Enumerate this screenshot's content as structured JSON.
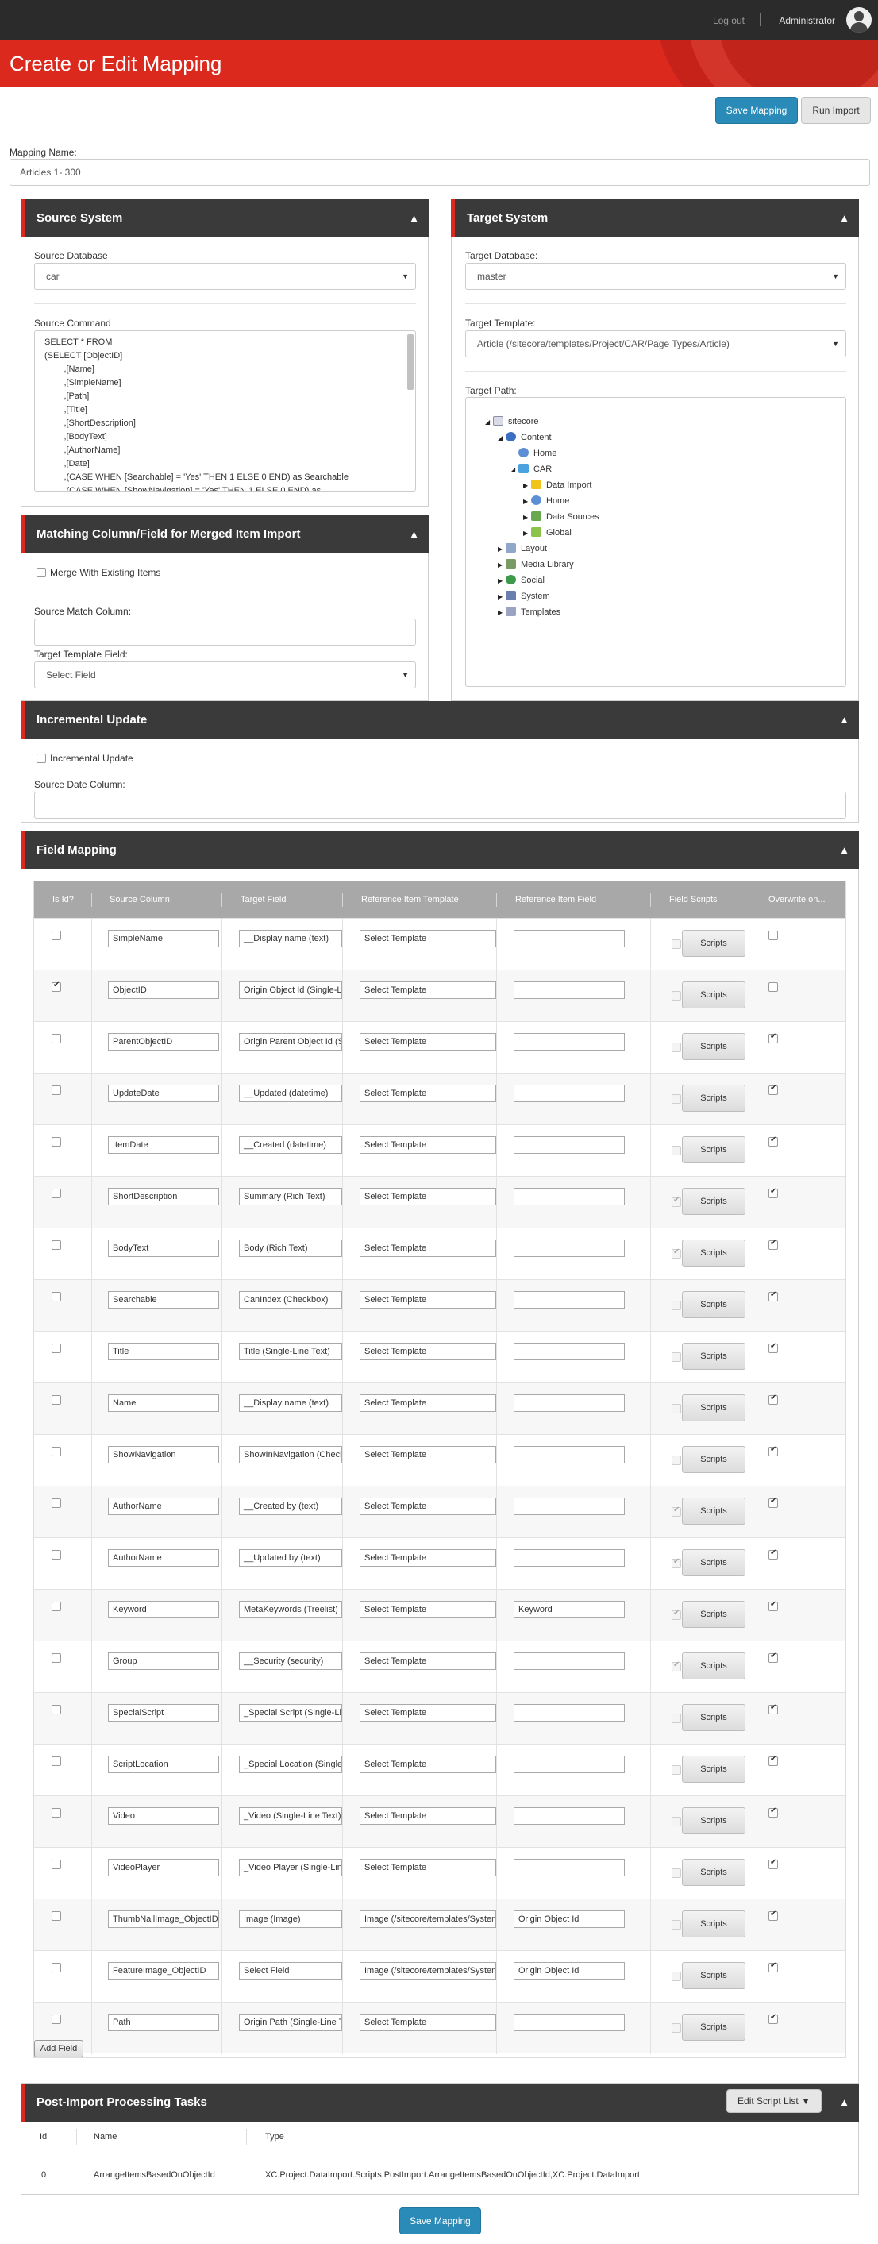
{
  "topbar": {
    "logout": "Log out",
    "user": "Administrator"
  },
  "page": {
    "title": "Create or Edit Mapping"
  },
  "actions": {
    "save": "Save Mapping",
    "run": "Run Import"
  },
  "mapping_name": {
    "label": "Mapping Name:",
    "value": "Articles 1- 300"
  },
  "source": {
    "title": "Source System",
    "db_label": "Source Database",
    "db_value": "car",
    "cmd_label": "Source Command",
    "cmd_text": "SELECT * FROM\n(SELECT [ObjectID]\n        ,[Name]\n        ,[SimpleName]\n        ,[Path]\n        ,[Title]\n        ,[ShortDescription]\n        ,[BodyText]\n        ,[AuthorName]\n        ,[Date]\n        ,(CASE WHEN [Searchable] = 'Yes' THEN 1 ELSE 0 END) as Searchable\n        ,(CASE WHEN [ShowNavigation] = 'Yes' THEN 1 ELSE 0 END) as"
  },
  "target": {
    "title": "Target System",
    "db_label": "Target Database:",
    "db_value": "master",
    "tpl_label": "Target Template:",
    "tpl_value": "Article (/sitecore/templates/Project/CAR/Page Types/Article)",
    "path_label": "Target Path:",
    "tree": [
      "sitecore",
      "Content",
      "Home",
      "CAR",
      "Data Import",
      "Home",
      "Data Sources",
      "Global",
      "Layout",
      "Media Library",
      "Social",
      "System",
      "Templates"
    ]
  },
  "merge": {
    "title": "Matching Column/Field for Merged Item Import",
    "checkbox": "Merge With Existing Items",
    "match_label": "Source Match Column:",
    "tpl_field_label": "Target Template Field:",
    "tpl_field_value": "Select Field"
  },
  "incremental": {
    "title": "Incremental Update",
    "checkbox": "Incremental Update",
    "date_label": "Source Date Column:"
  },
  "field_mapping": {
    "title": "Field Mapping",
    "columns": [
      "Is Id?",
      "Source Column",
      "Target Field",
      "Reference Item Template",
      "Reference Item Field",
      "Field Scripts",
      "Overwrite on..."
    ],
    "scripts_label": "Scripts",
    "add_field": "Add Field",
    "rows": [
      {
        "isid": false,
        "source": "SimpleName",
        "target": "__Display name (text)",
        "tpl": "Select Template",
        "ref": "",
        "script": false,
        "ow": false
      },
      {
        "isid": true,
        "source": "ObjectID",
        "target": "Origin Object Id (Single-Line Text)",
        "tpl": "Select Template",
        "ref": "",
        "script": false,
        "ow": false
      },
      {
        "isid": false,
        "source": "ParentObjectID",
        "target": "Origin Parent Object Id (Single-Line Text)",
        "tpl": "Select Template",
        "ref": "",
        "script": false,
        "ow": true
      },
      {
        "isid": false,
        "source": "UpdateDate",
        "target": "__Updated (datetime)",
        "tpl": "Select Template",
        "ref": "",
        "script": false,
        "ow": true
      },
      {
        "isid": false,
        "source": "ItemDate",
        "target": "__Created (datetime)",
        "tpl": "Select Template",
        "ref": "",
        "script": false,
        "ow": true
      },
      {
        "isid": false,
        "source": "ShortDescription",
        "target": "Summary (Rich Text)",
        "tpl": "Select Template",
        "ref": "",
        "script": true,
        "ow": true
      },
      {
        "isid": false,
        "source": "BodyText",
        "target": "Body (Rich Text)",
        "tpl": "Select Template",
        "ref": "",
        "script": true,
        "ow": true
      },
      {
        "isid": false,
        "source": "Searchable",
        "target": "CanIndex (Checkbox)",
        "tpl": "Select Template",
        "ref": "",
        "script": false,
        "ow": true
      },
      {
        "isid": false,
        "source": "Title",
        "target": "Title (Single-Line Text)",
        "tpl": "Select Template",
        "ref": "",
        "script": false,
        "ow": true
      },
      {
        "isid": false,
        "source": "Name",
        "target": "__Display name (text)",
        "tpl": "Select Template",
        "ref": "",
        "script": false,
        "ow": true
      },
      {
        "isid": false,
        "source": "ShowNavigation",
        "target": "ShowInNavigation (Checkbox)",
        "tpl": "Select Template",
        "ref": "",
        "script": false,
        "ow": true
      },
      {
        "isid": false,
        "source": "AuthorName",
        "target": "__Created by (text)",
        "tpl": "Select Template",
        "ref": "",
        "script": true,
        "ow": true
      },
      {
        "isid": false,
        "source": "AuthorName",
        "target": "__Updated by (text)",
        "tpl": "Select Template",
        "ref": "",
        "script": true,
        "ow": true
      },
      {
        "isid": false,
        "source": "Keyword",
        "target": "MetaKeywords (Treelist)",
        "tpl": "Select Template",
        "ref": "Keyword",
        "script": true,
        "ow": true
      },
      {
        "isid": false,
        "source": "Group",
        "target": "__Security (security)",
        "tpl": "Select Template",
        "ref": "",
        "script": true,
        "ow": true
      },
      {
        "isid": false,
        "source": "SpecialScript",
        "target": "_Special Script (Single-Line Text)",
        "tpl": "Select Template",
        "ref": "",
        "script": false,
        "ow": true
      },
      {
        "isid": false,
        "source": "ScriptLocation",
        "target": "_Special Location (Single-Line Text)",
        "tpl": "Select Template",
        "ref": "",
        "script": false,
        "ow": true
      },
      {
        "isid": false,
        "source": "Video",
        "target": "_Video (Single-Line Text)",
        "tpl": "Select Template",
        "ref": "",
        "script": false,
        "ow": true
      },
      {
        "isid": false,
        "source": "VideoPlayer",
        "target": "_Video Player (Single-Line Text)",
        "tpl": "Select Template",
        "ref": "",
        "script": false,
        "ow": true
      },
      {
        "isid": false,
        "source": "ThumbNailImage_ObjectID",
        "target": "Image (Image)",
        "tpl": "Image (/sitecore/templates/System/Media)",
        "ref": "Origin Object Id",
        "script": false,
        "ow": true
      },
      {
        "isid": false,
        "source": "FeatureImage_ObjectID",
        "target": "Select Field",
        "tpl": "Image (/sitecore/templates/System/Media)",
        "ref": "Origin Object Id",
        "script": false,
        "ow": true
      },
      {
        "isid": false,
        "source": "Path",
        "target": "Origin Path (Single-Line Text)",
        "tpl": "Select Template",
        "ref": "",
        "script": false,
        "ow": true
      }
    ]
  },
  "post_import": {
    "title": "Post-Import Processing Tasks",
    "edit_button": "Edit Script List",
    "columns": [
      "Id",
      "Name",
      "Type"
    ],
    "rows": [
      {
        "id": "0",
        "name": "ArrangeItemsBasedOnObjectId",
        "type": "XC.Project.DataImport.Scripts.PostImport.ArrangeItemsBasedOnObjectId,XC.Project.DataImport"
      }
    ]
  },
  "footer": {
    "save": "Save Mapping"
  },
  "colors": {
    "brand_red": "#dc291e",
    "primary_blue": "#2a8ab8",
    "panel_header": "#3a3a3a"
  }
}
